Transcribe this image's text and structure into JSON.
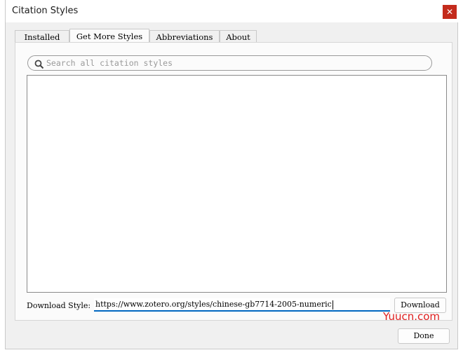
{
  "window": {
    "title": "Citation Styles",
    "close_symbol": "✕"
  },
  "tabs": [
    {
      "label": "Installed",
      "selected": false
    },
    {
      "label": "Get More Styles",
      "selected": true
    },
    {
      "label": "Abbreviations",
      "selected": false
    },
    {
      "label": "About",
      "selected": false
    }
  ],
  "search": {
    "placeholder": "Search all citation styles",
    "value": ""
  },
  "download": {
    "label": "Download Style:",
    "url": "https://www.zotero.org/styles/chinese-gb7714-2005-numeric",
    "button_label": "Download"
  },
  "footer": {
    "done_label": "Done"
  },
  "watermark": "Yuucn.com",
  "colors": {
    "accent": "#0067c0",
    "close": "#c42b1c",
    "watermark": "#e02020"
  }
}
